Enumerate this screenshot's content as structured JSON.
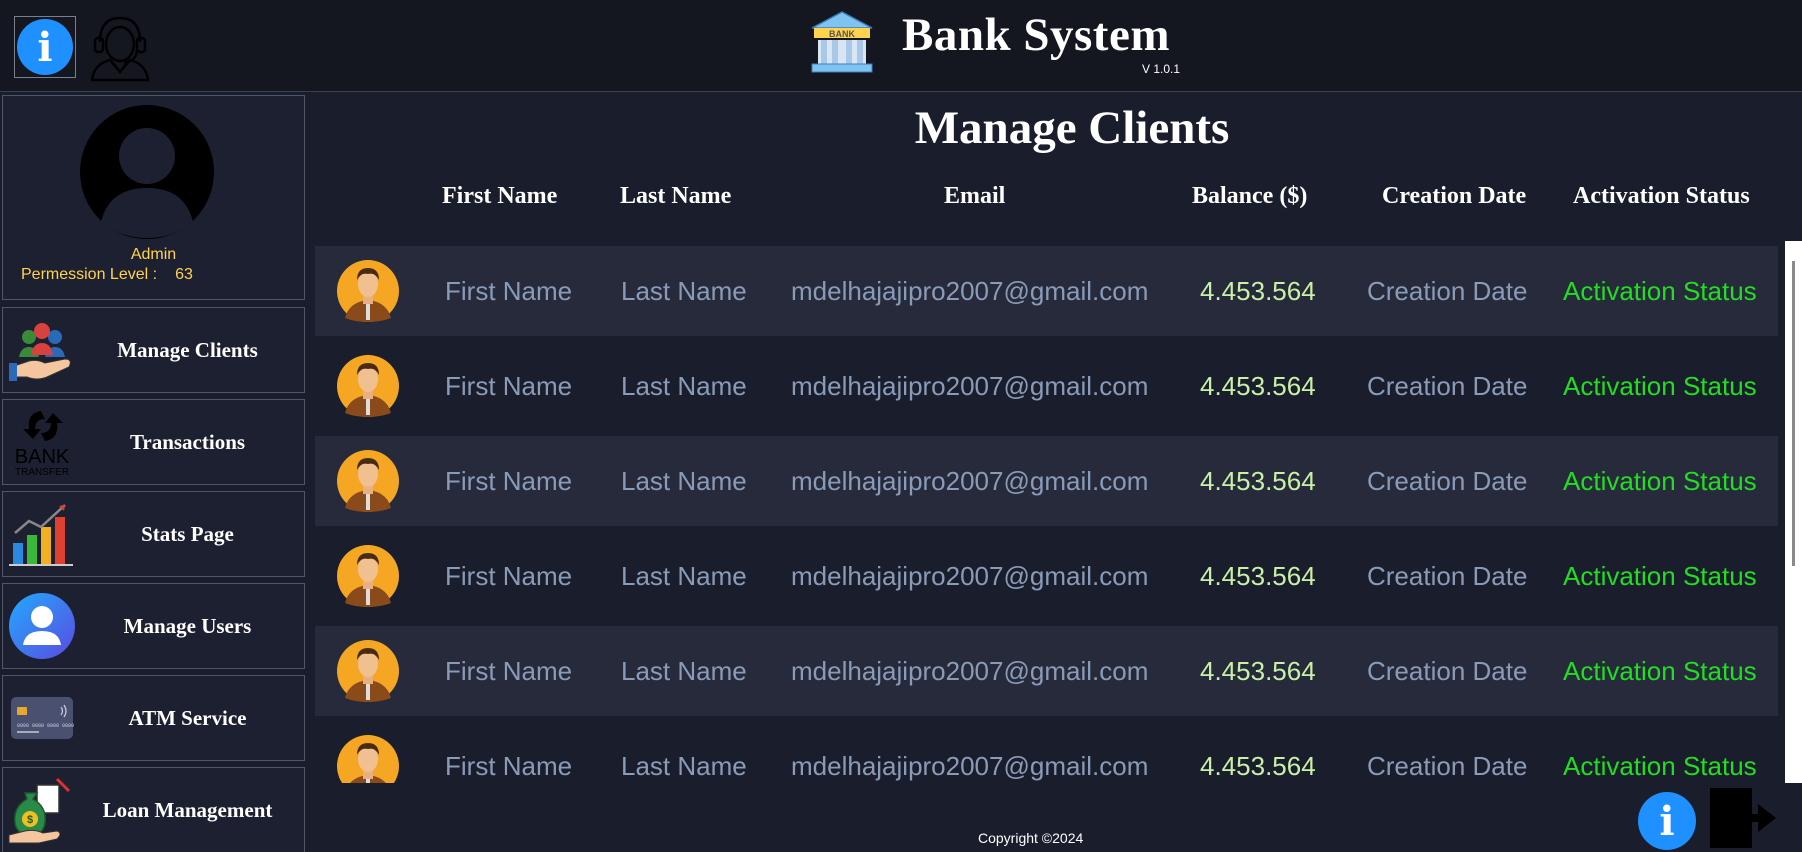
{
  "header": {
    "title": "Bank System",
    "version": "V 1.0.1",
    "bank_logo_text": "BANK",
    "info_icon": "info-icon",
    "support_icon": "support-agent-icon"
  },
  "profile": {
    "role": "Admin",
    "permission_label": "Permession Level :",
    "permission_value": "63"
  },
  "sidebar": {
    "items": [
      {
        "label": "Manage Clients",
        "icon": "clients-hand-icon"
      },
      {
        "label": "Transactions",
        "icon": "bank-transfer-icon"
      },
      {
        "label": "Stats Page",
        "icon": "bar-chart-icon"
      },
      {
        "label": "Manage Users",
        "icon": "user-icon"
      },
      {
        "label": "ATM Service",
        "icon": "credit-card-icon"
      },
      {
        "label": "Loan Management",
        "icon": "money-bag-icon"
      }
    ]
  },
  "main": {
    "title": "Manage Clients",
    "columns": [
      "First Name",
      "Last Name",
      "Email",
      "Balance ($)",
      "Creation Date",
      "Activation Status"
    ],
    "rows": [
      {
        "first": "First Name",
        "last": "Last Name",
        "email": "mdelhajajipro2007@gmail.com",
        "balance": "4.453.564",
        "date": "Creation Date",
        "status": "Activation Status"
      },
      {
        "first": "First Name",
        "last": "Last Name",
        "email": "mdelhajajipro2007@gmail.com",
        "balance": "4.453.564",
        "date": "Creation Date",
        "status": "Activation Status"
      },
      {
        "first": "First Name",
        "last": "Last Name",
        "email": "mdelhajajipro2007@gmail.com",
        "balance": "4.453.564",
        "date": "Creation Date",
        "status": "Activation Status"
      },
      {
        "first": "First Name",
        "last": "Last Name",
        "email": "mdelhajajipro2007@gmail.com",
        "balance": "4.453.564",
        "date": "Creation Date",
        "status": "Activation Status"
      },
      {
        "first": "First Name",
        "last": "Last Name",
        "email": "mdelhajajipro2007@gmail.com",
        "balance": "4.453.564",
        "date": "Creation Date",
        "status": "Activation Status"
      },
      {
        "first": "First Name",
        "last": "Last Name",
        "email": "mdelhajajipro2007@gmail.com",
        "balance": "4.453.564",
        "date": "Creation Date",
        "status": "Activation Status"
      }
    ]
  },
  "footer": {
    "copyright": "Copyright ©2024",
    "logout_icon": "logout-icon"
  },
  "colors": {
    "background": "#1a1d2b",
    "header": "#141620",
    "row_alt": "#262a3b",
    "accent_blue": "#1e90ff",
    "admin_yellow": "#ffd34d",
    "status_green": "#22dd22",
    "balance_green": "#c8f0a8",
    "muted_text": "#8a9bb8"
  }
}
